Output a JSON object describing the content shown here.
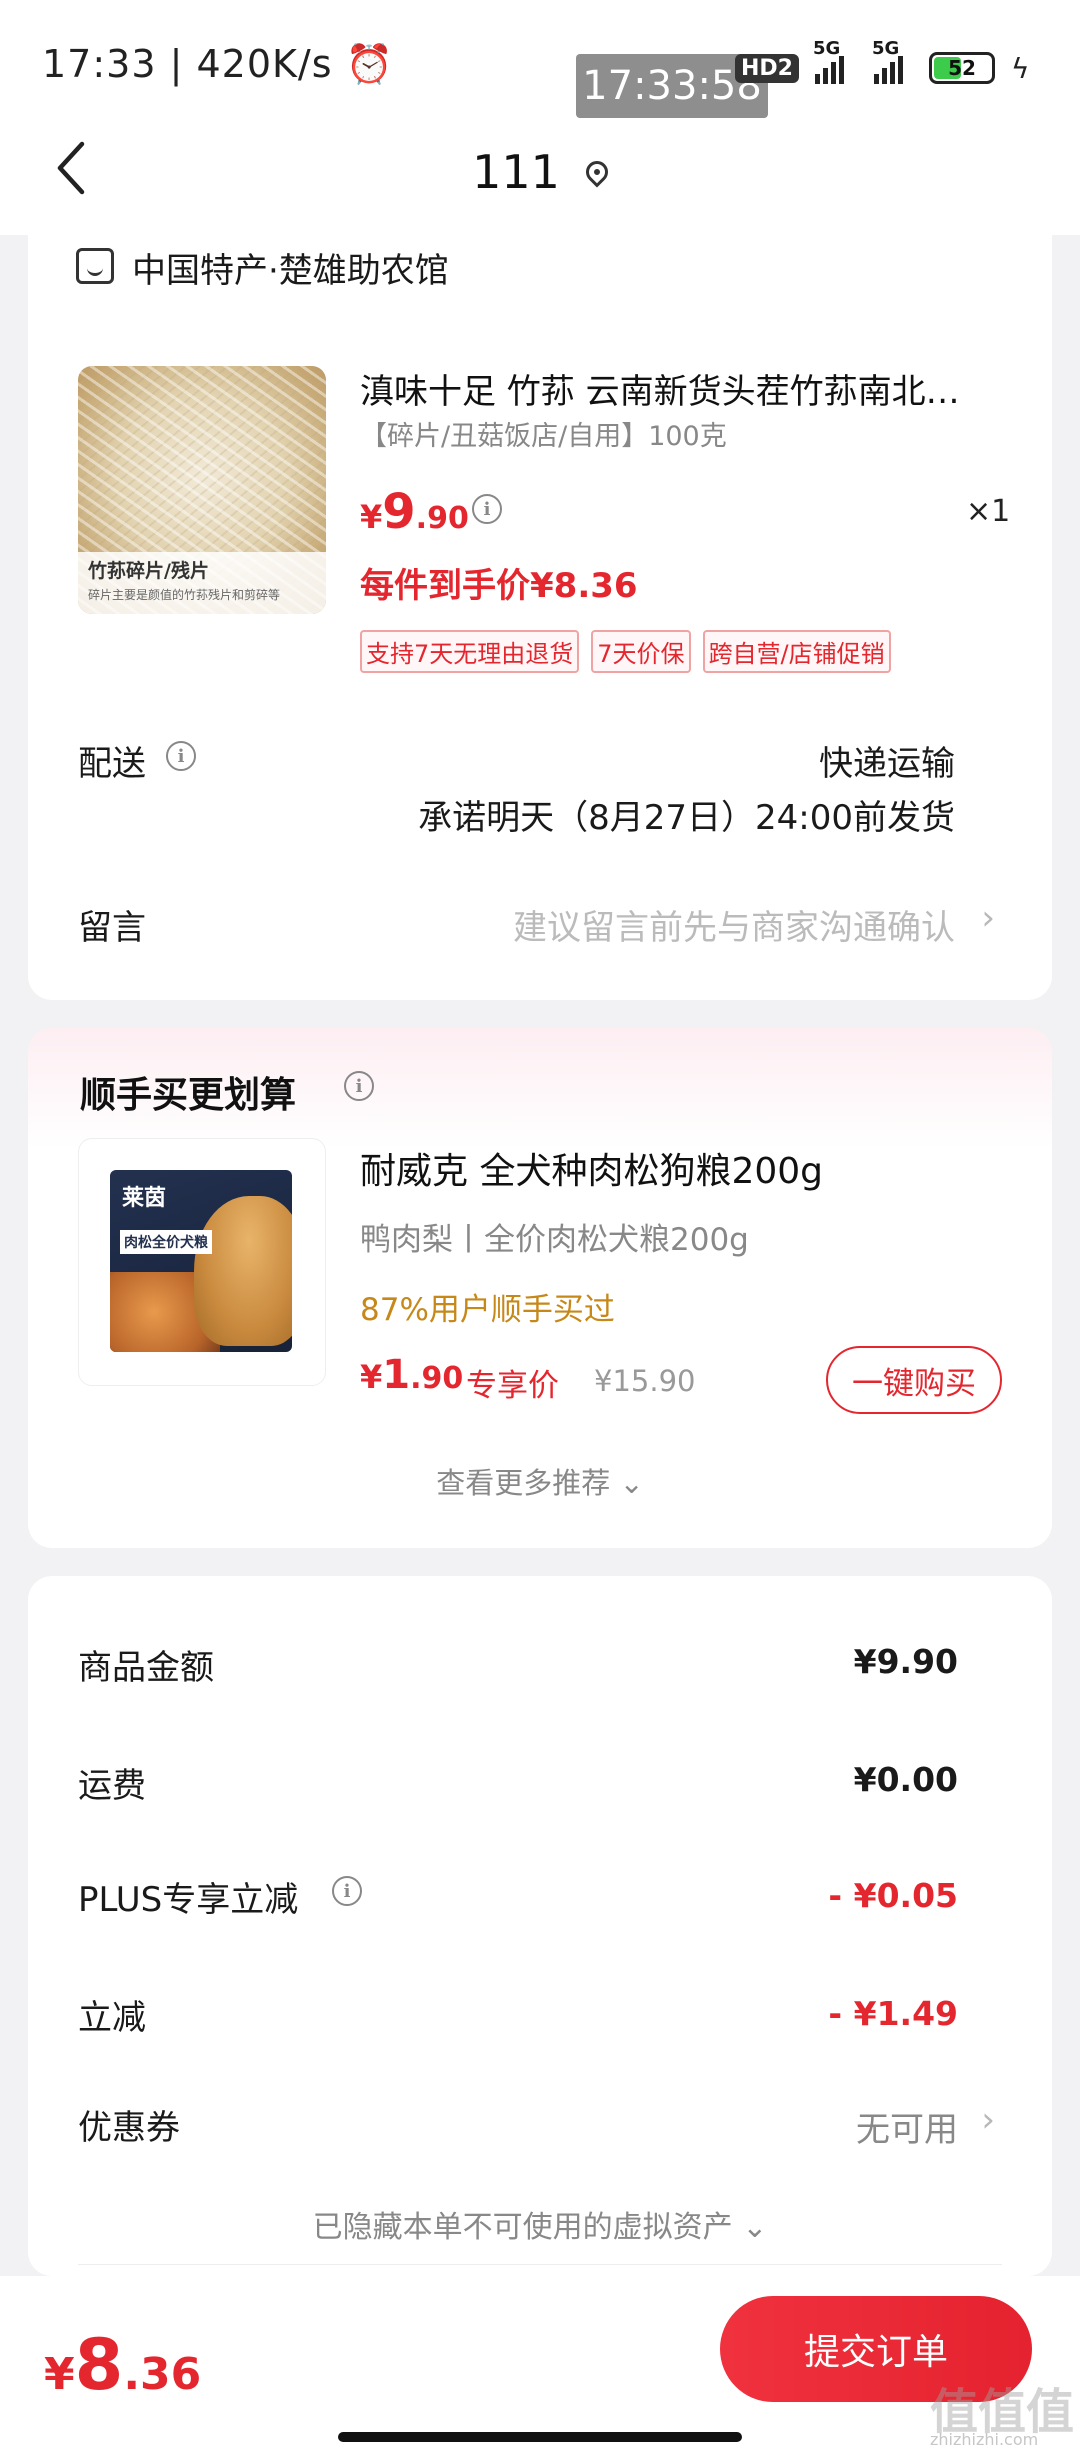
{
  "status_bar": {
    "time_speed": "17:33 | 420K/s ⏰",
    "clock_overlay": "17:33:58",
    "hd": "HD2",
    "network1": "5G",
    "network2": "5G",
    "battery": "52",
    "battery_level_percent": 52
  },
  "nav": {
    "title": "111"
  },
  "store": {
    "name": "中国特产·楚雄助农馆"
  },
  "product": {
    "thumb_caption": "竹荪碎片/残片",
    "thumb_subcaption": "碎片主要是颜值的竹荪残片和剪碎等",
    "title": "滇味十足 竹荪 云南新货头茬竹荪南北…",
    "spec": "【碎片/丑菇饭店/自用】100克",
    "price_symbol": "¥",
    "price_int": "9",
    "price_dec": ".90",
    "qty": "×1",
    "after_price": "每件到手价¥8.36",
    "tags": [
      "支持7天无理由退货",
      "7天价保",
      "跨自营/店铺促销"
    ]
  },
  "shipping": {
    "label": "配送",
    "method": "快递运输",
    "promise": "承诺明天（8月27日）24:00前发货"
  },
  "message": {
    "label": "留言",
    "placeholder": "建议留言前先与商家沟通确认"
  },
  "recommend": {
    "section_title": "顺手买更划算",
    "bag_brand": "莱茵",
    "bag_name": "肉松全价犬粮",
    "title": "耐威克 全犬种肉松狗粮200g",
    "spec": "鸭肉梨丨全价肉松犬粮200g",
    "pct": "87%用户顺手买过",
    "price_symbol": "¥",
    "price_int": "1",
    "price_dec": ".90",
    "exclusive": "专享价",
    "original": "¥15.90",
    "buy_label": "一键购买",
    "more": "查看更多推荐 ⌄"
  },
  "summary": {
    "rows": [
      {
        "label": "商品金额",
        "value": "¥9.90"
      },
      {
        "label": "运费",
        "value": "¥0.00"
      },
      {
        "label": "PLUS专享立减",
        "value": "- ¥0.05"
      },
      {
        "label": "立减",
        "value": "- ¥1.49"
      }
    ],
    "coupon_label": "优惠券",
    "coupon_value": "无可用",
    "hidden_note": "已隐藏本单不可使用的虚拟资产 ⌄"
  },
  "bottom": {
    "total_symbol": "¥",
    "total_int": "8",
    "total_dec": ".36",
    "submit": "提交订单",
    "watermark": "值值值",
    "watermark_url": "zhizhizhi.com"
  },
  "colors": {
    "accent": "#e4262e",
    "gold": "#c7881a"
  }
}
